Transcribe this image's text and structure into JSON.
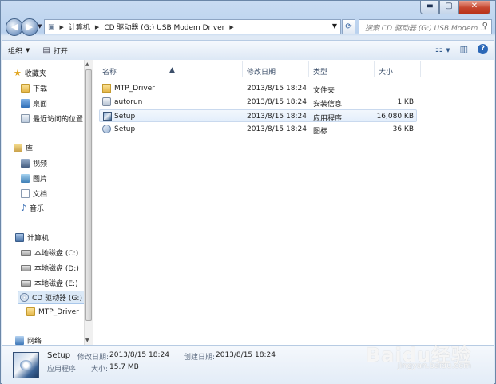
{
  "window": {
    "title_buttons": {
      "minimize": "▬",
      "maximize": "▢",
      "close": "✕"
    }
  },
  "address": {
    "segments": [
      "计算机",
      "CD 驱动器 (G:) USB Modem Driver"
    ],
    "search_placeholder": "搜索 CD 驱动器 (G:) USB Modem ..."
  },
  "toolbar": {
    "organize_label": "组织",
    "open_label": "打开"
  },
  "nav": {
    "favorites": "收藏夹",
    "downloads": "下载",
    "desktop": "桌面",
    "recent": "最近访问的位置",
    "libraries": "库",
    "videos": "视频",
    "pictures": "图片",
    "documents": "文档",
    "music": "音乐",
    "computer": "计算机",
    "disk_c": "本地磁盘 (C:)",
    "disk_d": "本地磁盘 (D:)",
    "disk_e": "本地磁盘 (E:)",
    "cd_g": "CD 驱动器 (G:) U",
    "mtp_driver": "MTP_Driver",
    "network": "网络"
  },
  "columns": {
    "name": "名称",
    "date": "修改日期",
    "type": "类型",
    "size": "大小"
  },
  "files": [
    {
      "name": "MTP_Driver",
      "date": "2013/8/15 18:24",
      "type": "文件夹",
      "size": "",
      "icon": "folder-icon"
    },
    {
      "name": "autorun",
      "date": "2013/8/15 18:24",
      "type": "安装信息",
      "size": "1 KB",
      "icon": "setup-info-icon"
    },
    {
      "name": "Setup",
      "date": "2013/8/15 18:24",
      "type": "应用程序",
      "size": "16,080 KB",
      "icon": "application-icon"
    },
    {
      "name": "Setup",
      "date": "2013/8/15 18:24",
      "type": "图标",
      "size": "36 KB",
      "icon": "icon-file-icon"
    }
  ],
  "details": {
    "name": "Setup",
    "modified_label": "修改日期:",
    "modified": "2013/8/15 18:24",
    "created_label": "创建日期:",
    "created": "2013/8/15 18:24",
    "type": "应用程序",
    "size_label": "大小:",
    "size": "15.7 MB"
  },
  "watermark": {
    "logo": "Baidu经验",
    "url": "jingyan.baidu.com"
  },
  "colors": {
    "selection": "#dbe9f7",
    "chrome": "#c9dcf2"
  }
}
